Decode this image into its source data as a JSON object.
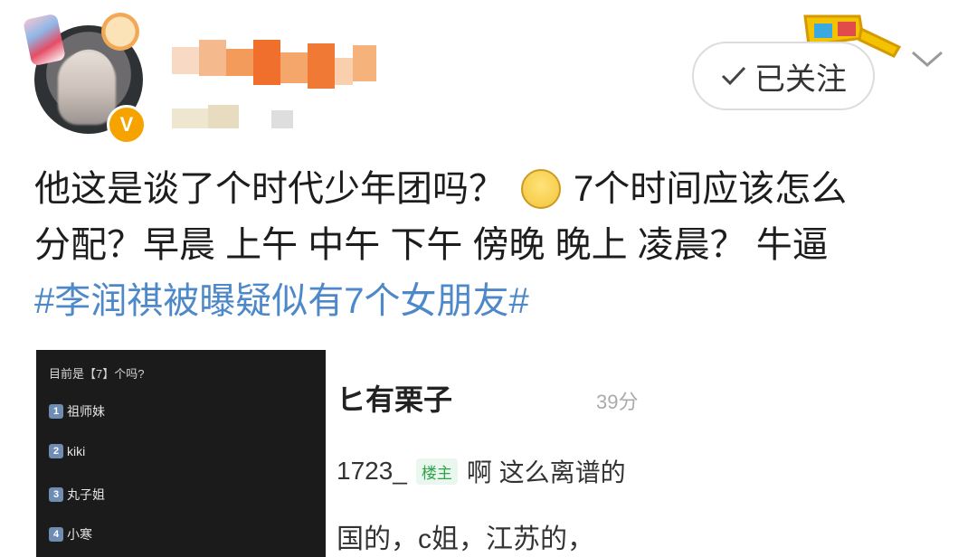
{
  "header": {
    "follow_button_label": "已关注",
    "verified_badge": "V"
  },
  "post": {
    "line1_a": "他这是谈了个时代少年团吗？",
    "line1_b": "7个时间应该怎么",
    "line2": "分配？早晨 上午 中午 下午 傍晚 晚上 凌晨？  牛逼",
    "hashtag": "#李润祺被曝疑似有7个女朋友#"
  },
  "screenshot_left": {
    "question": "目前是【7】个吗?",
    "items": [
      {
        "num": "1",
        "label": "祖师妹"
      },
      {
        "num": "2",
        "label": "kiki"
      },
      {
        "num": "3",
        "label": "丸子姐"
      },
      {
        "num": "4",
        "label": "小寒"
      }
    ]
  },
  "screenshot_right": {
    "title": "ヒ有栗子",
    "time": "39分",
    "user": "1723_",
    "owner_tag": "楼主",
    "reply": "啊 这么离谱的",
    "line3": "国的，c姐，江苏的，"
  },
  "icons": {
    "follow": "check-icon",
    "more": "chevron-down-icon",
    "emoji": "smiling-face-icon",
    "decoration": "3d-glasses-icon"
  },
  "colors": {
    "hashtag": "#4d88c8",
    "badge": "#f6a300",
    "owner_tag": "#2fa24a"
  }
}
